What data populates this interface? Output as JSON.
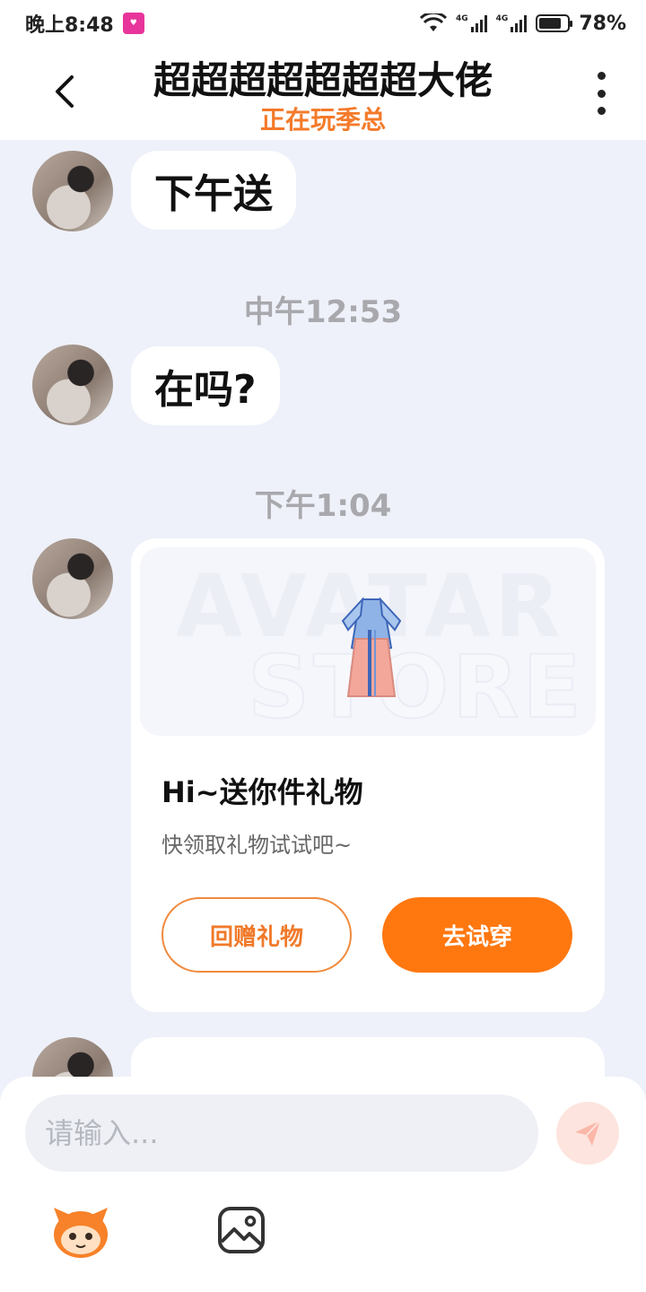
{
  "status_bar": {
    "time": "晚上8:48",
    "network_1": "4G",
    "network_2": "4G",
    "battery_percent": "78%",
    "battery_level": 0.78
  },
  "header": {
    "title": "超超超超超超超大佬",
    "subtitle": "正在玩季总"
  },
  "messages": [
    {
      "type": "text",
      "text": "下午送"
    },
    {
      "type": "time",
      "text": "中午12:53"
    },
    {
      "type": "text",
      "text": "在吗?"
    },
    {
      "type": "time",
      "text": "下午1:04"
    }
  ],
  "gift_card": {
    "banner_watermark_1": "AVATAR",
    "banner_watermark_2": "STORE",
    "title": "Hi~送你件礼物",
    "description": "快领取礼物试试吧~",
    "return_gift_label": "回赠礼物",
    "try_on_label": "去试穿"
  },
  "composer": {
    "placeholder": "请输入..."
  },
  "icons": {
    "back": "chevron-left-icon",
    "more": "more-vertical-icon",
    "send": "send-icon",
    "emoji": "mascot-emoji-icon",
    "image": "image-icon"
  },
  "colors": {
    "accent_orange": "#ff770f",
    "subtitle_orange": "#f47a2a",
    "background": "#eef1f9"
  }
}
